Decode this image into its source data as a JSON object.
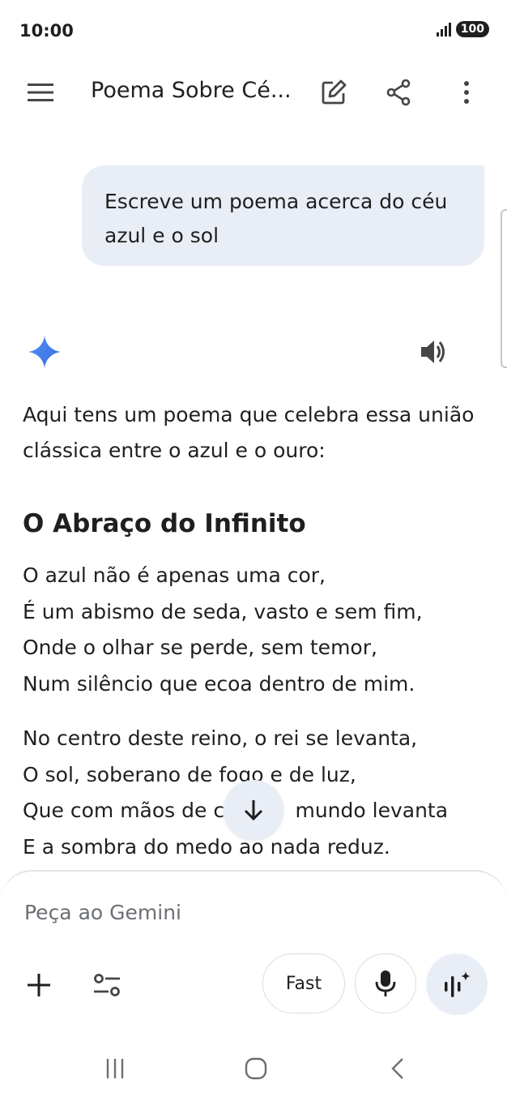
{
  "status_bar": {
    "time": "10:00",
    "battery": "100"
  },
  "header": {
    "title": "Poema Sobre Cé...",
    "icons": [
      "menu-icon",
      "edit-icon",
      "share-icon",
      "more-vert-icon"
    ]
  },
  "conversation": {
    "user_message": "Escreve um poema acerca do céu azul e o sol",
    "response": {
      "intro": "Aqui tens um poema que celebra essa união clássica entre o azul e o ouro:",
      "poem_title": "O Abraço do Infinito",
      "stanza1": [
        "O azul não é apenas uma cor,",
        "É um abismo de seda, vasto e sem fim,",
        "Onde o olhar se perde, sem temor,",
        "Num silêncio que ecoa dentro de mim."
      ],
      "stanza2": [
        "No centro deste reino, o rei se levanta,",
        "O sol, soberano de fogo e de luz,",
        "Que com mãos de c           mundo levanta",
        "E a sombra do medo ao nada reduz."
      ]
    }
  },
  "composer": {
    "placeholder": "Peça ao Gemini",
    "mode_label": "Fast"
  },
  "colors": {
    "bubble": "#e9eef6",
    "spark": "#4285f4",
    "text": "#1f1f1f"
  }
}
